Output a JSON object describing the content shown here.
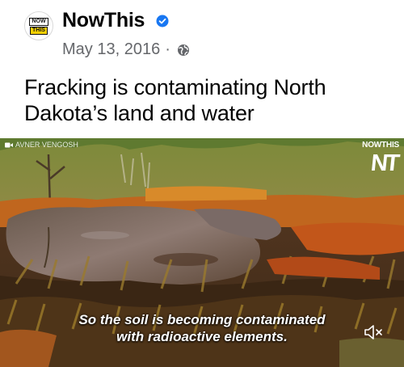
{
  "post": {
    "page_name": "NowThis",
    "logo_top": "NOW",
    "logo_bottom": "THIS",
    "date": "May 13, 2016",
    "separator": "·",
    "privacy_icon": "globe-icon",
    "verified_icon": "verified-badge-icon",
    "text": "Fracking is contaminating North Dakota’s land and water"
  },
  "video": {
    "credit": "AVNER VENGOSH",
    "watermark_text": "NOWTHIS",
    "watermark_mark": "NT",
    "caption_line1": "So the soil is becoming contaminated",
    "caption_line2": "with radioactive elements.",
    "mute_icon": "volume-muted-icon"
  },
  "colors": {
    "verified": "#1877f2",
    "secondary_text": "#65676b",
    "primary_text": "#050505",
    "logo_yellow": "#f4d000"
  }
}
